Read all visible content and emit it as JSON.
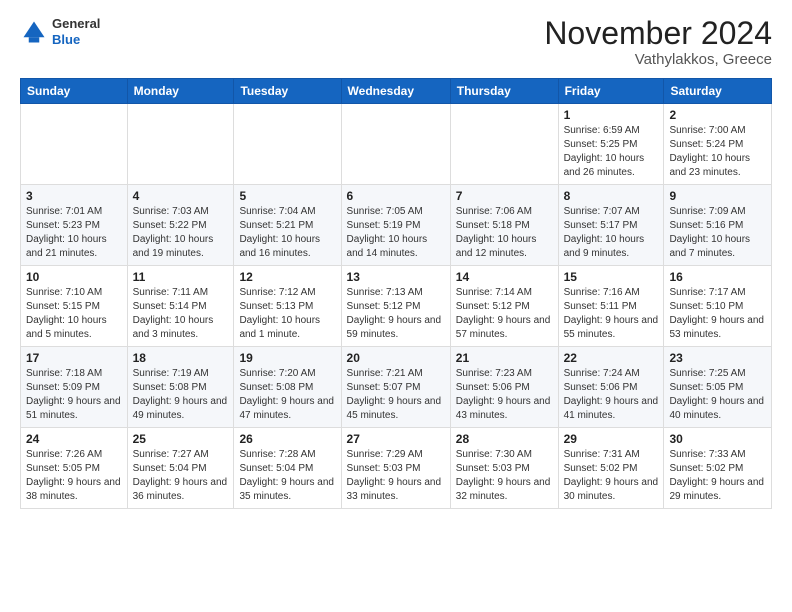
{
  "header": {
    "logo_general": "General",
    "logo_blue": "Blue",
    "month_title": "November 2024",
    "location": "Vathylakkos, Greece"
  },
  "calendar": {
    "days_of_week": [
      "Sunday",
      "Monday",
      "Tuesday",
      "Wednesday",
      "Thursday",
      "Friday",
      "Saturday"
    ],
    "weeks": [
      [
        {
          "day": "",
          "info": ""
        },
        {
          "day": "",
          "info": ""
        },
        {
          "day": "",
          "info": ""
        },
        {
          "day": "",
          "info": ""
        },
        {
          "day": "",
          "info": ""
        },
        {
          "day": "1",
          "info": "Sunrise: 6:59 AM\nSunset: 5:25 PM\nDaylight: 10 hours and 26 minutes."
        },
        {
          "day": "2",
          "info": "Sunrise: 7:00 AM\nSunset: 5:24 PM\nDaylight: 10 hours and 23 minutes."
        }
      ],
      [
        {
          "day": "3",
          "info": "Sunrise: 7:01 AM\nSunset: 5:23 PM\nDaylight: 10 hours and 21 minutes."
        },
        {
          "day": "4",
          "info": "Sunrise: 7:03 AM\nSunset: 5:22 PM\nDaylight: 10 hours and 19 minutes."
        },
        {
          "day": "5",
          "info": "Sunrise: 7:04 AM\nSunset: 5:21 PM\nDaylight: 10 hours and 16 minutes."
        },
        {
          "day": "6",
          "info": "Sunrise: 7:05 AM\nSunset: 5:19 PM\nDaylight: 10 hours and 14 minutes."
        },
        {
          "day": "7",
          "info": "Sunrise: 7:06 AM\nSunset: 5:18 PM\nDaylight: 10 hours and 12 minutes."
        },
        {
          "day": "8",
          "info": "Sunrise: 7:07 AM\nSunset: 5:17 PM\nDaylight: 10 hours and 9 minutes."
        },
        {
          "day": "9",
          "info": "Sunrise: 7:09 AM\nSunset: 5:16 PM\nDaylight: 10 hours and 7 minutes."
        }
      ],
      [
        {
          "day": "10",
          "info": "Sunrise: 7:10 AM\nSunset: 5:15 PM\nDaylight: 10 hours and 5 minutes."
        },
        {
          "day": "11",
          "info": "Sunrise: 7:11 AM\nSunset: 5:14 PM\nDaylight: 10 hours and 3 minutes."
        },
        {
          "day": "12",
          "info": "Sunrise: 7:12 AM\nSunset: 5:13 PM\nDaylight: 10 hours and 1 minute."
        },
        {
          "day": "13",
          "info": "Sunrise: 7:13 AM\nSunset: 5:12 PM\nDaylight: 9 hours and 59 minutes."
        },
        {
          "day": "14",
          "info": "Sunrise: 7:14 AM\nSunset: 5:12 PM\nDaylight: 9 hours and 57 minutes."
        },
        {
          "day": "15",
          "info": "Sunrise: 7:16 AM\nSunset: 5:11 PM\nDaylight: 9 hours and 55 minutes."
        },
        {
          "day": "16",
          "info": "Sunrise: 7:17 AM\nSunset: 5:10 PM\nDaylight: 9 hours and 53 minutes."
        }
      ],
      [
        {
          "day": "17",
          "info": "Sunrise: 7:18 AM\nSunset: 5:09 PM\nDaylight: 9 hours and 51 minutes."
        },
        {
          "day": "18",
          "info": "Sunrise: 7:19 AM\nSunset: 5:08 PM\nDaylight: 9 hours and 49 minutes."
        },
        {
          "day": "19",
          "info": "Sunrise: 7:20 AM\nSunset: 5:08 PM\nDaylight: 9 hours and 47 minutes."
        },
        {
          "day": "20",
          "info": "Sunrise: 7:21 AM\nSunset: 5:07 PM\nDaylight: 9 hours and 45 minutes."
        },
        {
          "day": "21",
          "info": "Sunrise: 7:23 AM\nSunset: 5:06 PM\nDaylight: 9 hours and 43 minutes."
        },
        {
          "day": "22",
          "info": "Sunrise: 7:24 AM\nSunset: 5:06 PM\nDaylight: 9 hours and 41 minutes."
        },
        {
          "day": "23",
          "info": "Sunrise: 7:25 AM\nSunset: 5:05 PM\nDaylight: 9 hours and 40 minutes."
        }
      ],
      [
        {
          "day": "24",
          "info": "Sunrise: 7:26 AM\nSunset: 5:05 PM\nDaylight: 9 hours and 38 minutes."
        },
        {
          "day": "25",
          "info": "Sunrise: 7:27 AM\nSunset: 5:04 PM\nDaylight: 9 hours and 36 minutes."
        },
        {
          "day": "26",
          "info": "Sunrise: 7:28 AM\nSunset: 5:04 PM\nDaylight: 9 hours and 35 minutes."
        },
        {
          "day": "27",
          "info": "Sunrise: 7:29 AM\nSunset: 5:03 PM\nDaylight: 9 hours and 33 minutes."
        },
        {
          "day": "28",
          "info": "Sunrise: 7:30 AM\nSunset: 5:03 PM\nDaylight: 9 hours and 32 minutes."
        },
        {
          "day": "29",
          "info": "Sunrise: 7:31 AM\nSunset: 5:02 PM\nDaylight: 9 hours and 30 minutes."
        },
        {
          "day": "30",
          "info": "Sunrise: 7:33 AM\nSunset: 5:02 PM\nDaylight: 9 hours and 29 minutes."
        }
      ]
    ]
  }
}
